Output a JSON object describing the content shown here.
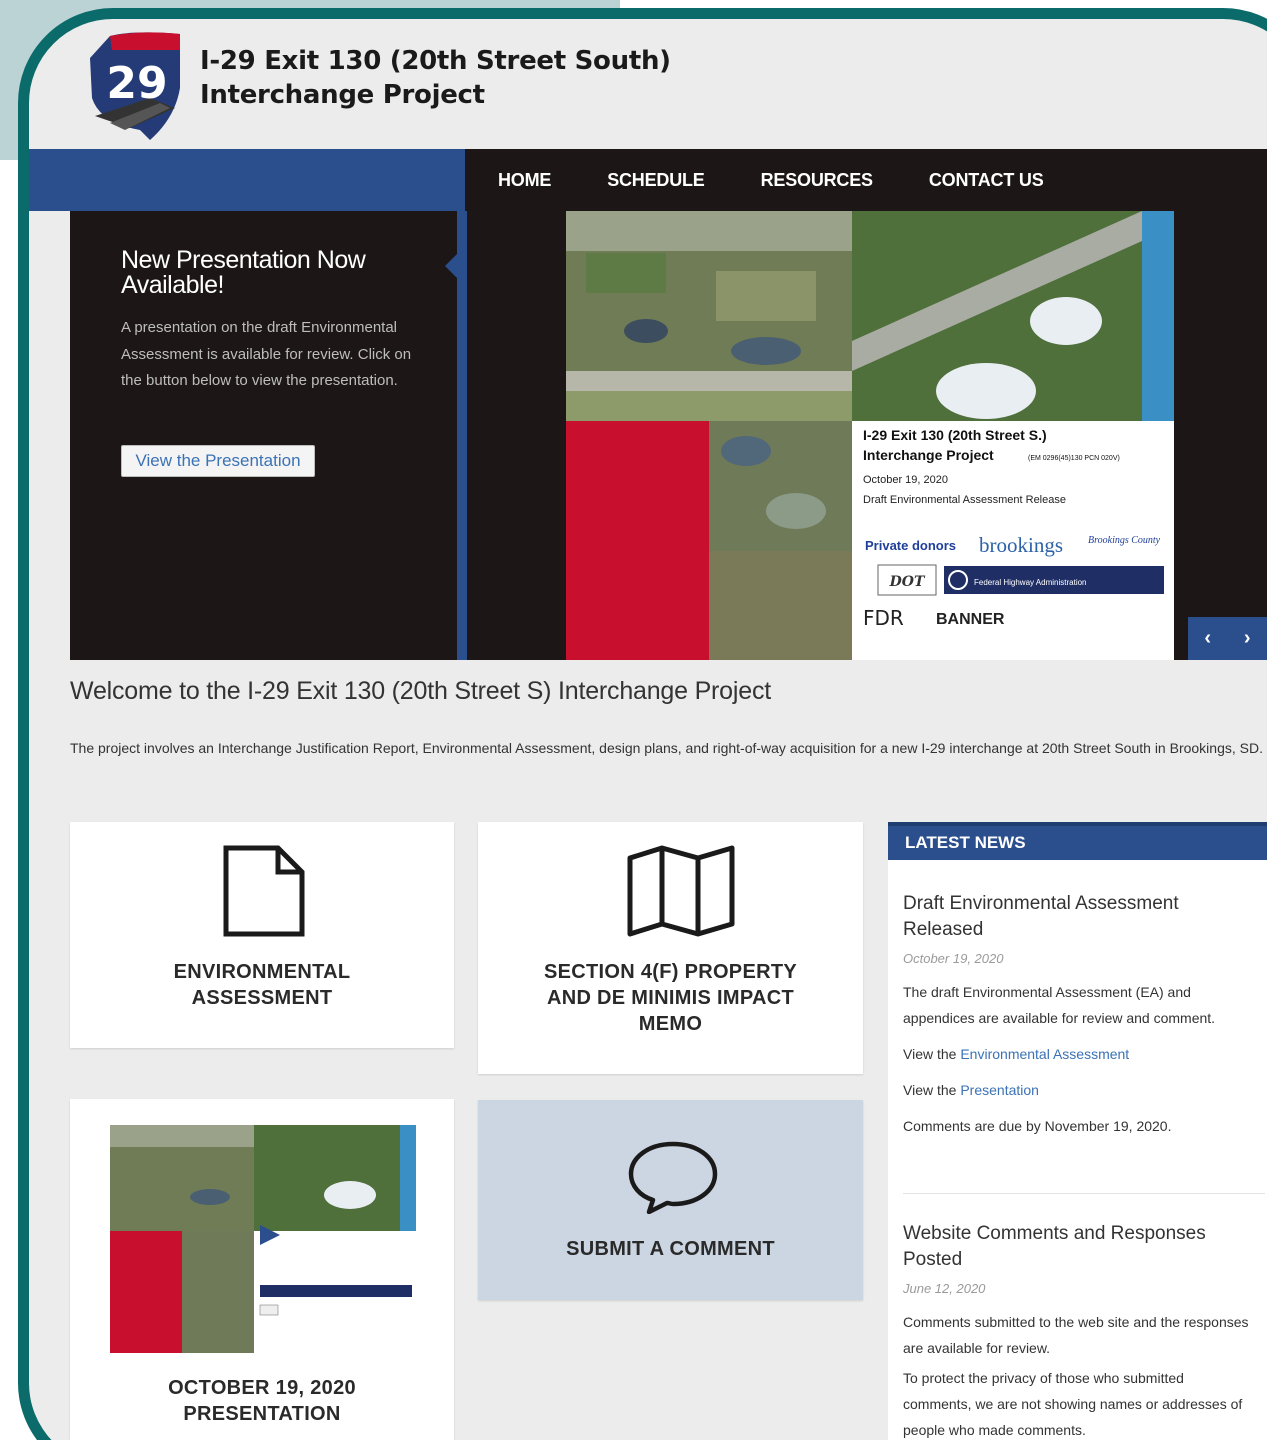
{
  "header": {
    "shield_number": "29",
    "title_line1": "I-29 Exit 130 (20th Street South)",
    "title_line2": "Interchange Project"
  },
  "nav": {
    "items": [
      "HOME",
      "SCHEDULE",
      "RESOURCES",
      "CONTACT US"
    ]
  },
  "hero": {
    "heading": "New Presentation Now Available!",
    "text": "A presentation on the draft Environmental Assessment is available for review. Click on the button below to view the presentation.",
    "button_label": "View the Presentation",
    "slide": {
      "title_line1": "I-29 Exit 130 (20th Street S.)",
      "title_line2": "Interchange Project",
      "title_code": "(EM 0296(45)130 PCN 020V)",
      "date": "October 19, 2020",
      "subtitle": "Draft Environmental Assessment Release",
      "private_donors": "Private donors",
      "brookings": "brookings",
      "county": "Brookings County",
      "dot": "DOT",
      "fhwa": "Federal Highway Administration",
      "hdr": "FDR",
      "banner": "BANNER"
    },
    "prev_label": "‹",
    "next_label": "›"
  },
  "welcome": {
    "title": "Welcome to the I-29 Exit 130 (20th Street S) Interchange Project",
    "text": "The project involves an Interchange Justification Report, Environmental Assessment, design plans, and right-of-way acquisition for a new I-29 interchange at 20th Street South in Brookings, SD."
  },
  "cards": {
    "environmental_line1": "ENVIRONMENTAL",
    "environmental_line2": "ASSESSMENT",
    "section4f_line1": "SECTION 4(F) PROPERTY",
    "section4f_line2": "AND DE MINIMIS IMPACT",
    "section4f_line3": "MEMO",
    "presentation_line1": "OCTOBER 19, 2020",
    "presentation_line2": "PRESENTATION",
    "comment": "SUBMIT A COMMENT"
  },
  "news": {
    "header": "LATEST NEWS",
    "items": [
      {
        "title": "Draft Environmental Assessment Released",
        "date": "October 19, 2020",
        "body": "The draft Environmental Assessment (EA) and appendices are available for review and comment.",
        "view_prefix": "View the ",
        "link1": "Environmental Assessment",
        "link2": "Presentation",
        "due": "Comments are due by November 19, 2020."
      },
      {
        "title": "Website Comments and Responses Posted",
        "date": "June 12, 2020",
        "body": "Comments submitted to the web site and the responses are available for review.",
        "body2": "To protect the privacy of those who submitted comments, we are not showing names or addresses of people who made comments."
      }
    ]
  },
  "colors": {
    "frame": "#0b6b6a",
    "nav_blue": "#2b4e8c",
    "dark": "#1c1616",
    "link": "#3a72b5",
    "slide_red": "#c8102e"
  }
}
